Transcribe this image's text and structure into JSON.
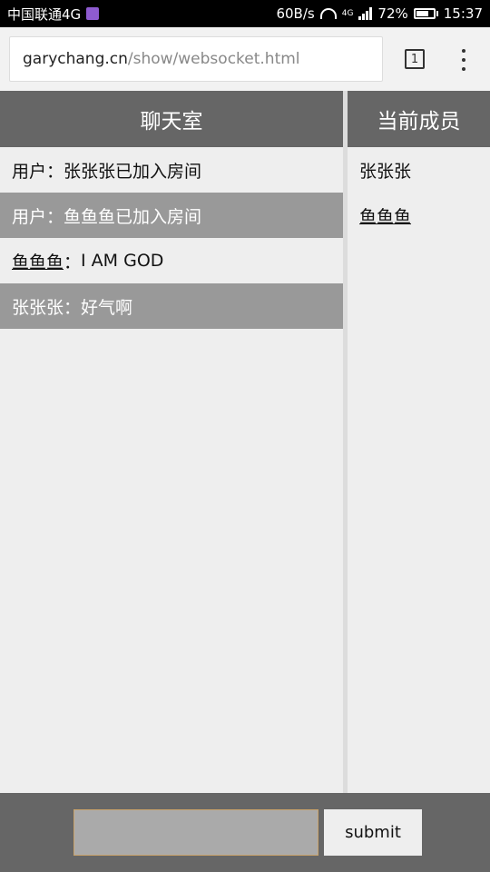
{
  "status_bar": {
    "carrier": "中国联通4G",
    "speed": "60B/s",
    "network_badge": "4G",
    "battery": "72%",
    "battery_level": 0.72,
    "time": "15:37"
  },
  "browser": {
    "url_host": "garychang.cn",
    "url_path": "/show/websocket.html",
    "tab_count": "1"
  },
  "chat": {
    "title": "聊天室",
    "messages": [
      {
        "sender": "用户",
        "separator": "：",
        "text": "张张张已加入房间"
      },
      {
        "sender": "用户",
        "separator": "：",
        "text": "鱼鱼鱼已加入房间"
      },
      {
        "sender": "鱼鱼鱼",
        "separator": "：",
        "text": "I AM GOD"
      },
      {
        "sender": "张张张",
        "separator": "：",
        "text": "好气啊"
      }
    ]
  },
  "members": {
    "title": "当前成员",
    "items": [
      {
        "name": "张张张"
      },
      {
        "name": "鱼鱼鱼"
      }
    ]
  },
  "composer": {
    "input_value": "",
    "submit_label": "submit"
  },
  "colors": {
    "header_bg": "#666666",
    "alt_row_bg": "#999999",
    "panel_bg": "#eeeeee"
  }
}
